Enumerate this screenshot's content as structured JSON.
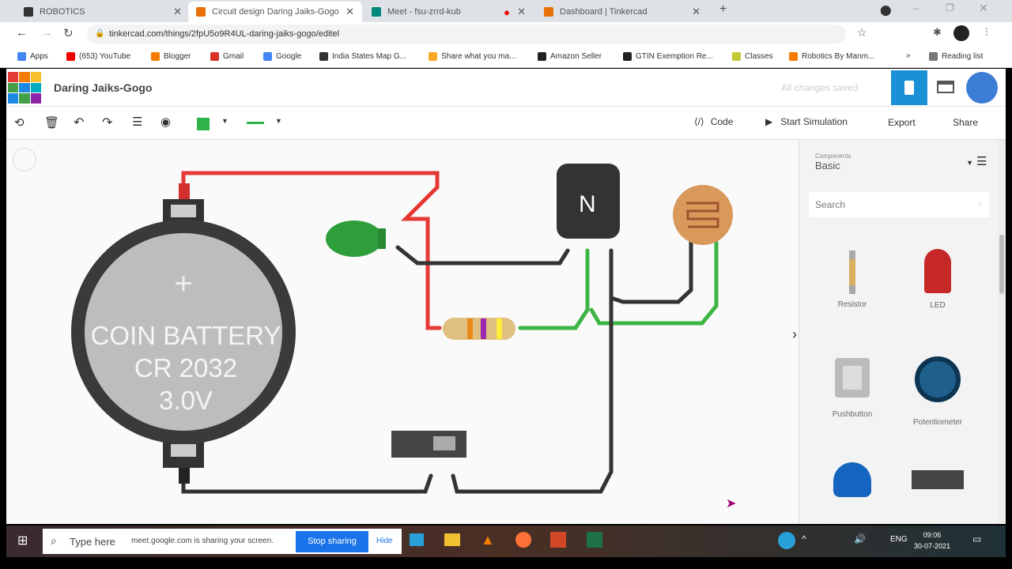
{
  "browser": {
    "tabs": [
      {
        "label": "ROBOTICS",
        "color": "#333"
      },
      {
        "label": "Circuit design Daring Jaiks-Gogo",
        "color": "#e8710a",
        "active": true
      },
      {
        "label": "Meet - fsu-zrrd-kub",
        "color": "#00897b"
      },
      {
        "label": "Dashboard | Tinkercad",
        "color": "#e8710a"
      }
    ],
    "url": "tinkercad.com/things/2fpU5o9R4UL-daring-jaiks-gogo/editel",
    "bookmarks": [
      {
        "label": "Apps",
        "color": "#4285f4"
      },
      {
        "label": "(653) YouTube",
        "color": "#e00"
      },
      {
        "label": "Blogger",
        "color": "#f57c00"
      },
      {
        "label": "Gmail",
        "color": "#d93025"
      },
      {
        "label": "Google",
        "color": "#4285f4"
      },
      {
        "label": "India States Map G...",
        "color": "#333"
      },
      {
        "label": "Share what you ma...",
        "color": "#f9a825"
      },
      {
        "label": "Amazon Seller",
        "color": "#222"
      },
      {
        "label": "GTIN Exemption Re...",
        "color": "#222"
      },
      {
        "label": "Classes",
        "color": "#c0ca33"
      },
      {
        "label": "Robotics By Manm...",
        "color": "#f57c00"
      }
    ],
    "reading_list": "Reading list"
  },
  "app": {
    "logo": "TINKERCAD",
    "title": "Daring Jaiks-Gogo",
    "save_status": "All changes saved",
    "accent": "#1a91d6",
    "toolbar": {
      "code": "Code",
      "start_sim": "Start Simulation",
      "export": "Export",
      "share": "Share",
      "color": "#2db34a"
    },
    "panel": {
      "components_label": "Components",
      "components_value": "Basic",
      "search_placeholder": "Search",
      "items": [
        {
          "label": "Resistor"
        },
        {
          "label": "LED"
        },
        {
          "label": "Pushbutton"
        },
        {
          "label": "Potentiometer"
        },
        {
          "label": ""
        },
        {
          "label": ""
        }
      ]
    },
    "circuit": {
      "battery": {
        "line1": "COIN BATTERY",
        "line2": "CR 2032",
        "line3": "3.0V"
      },
      "transistor_label": "N"
    }
  },
  "taskbar": {
    "search": "Type here",
    "share_msg": "meet.google.com is sharing your screen.",
    "stop_sharing": "Stop sharing",
    "hide": "Hide",
    "time": "09:06",
    "date": "30-07-2021",
    "lang": "ENG"
  }
}
